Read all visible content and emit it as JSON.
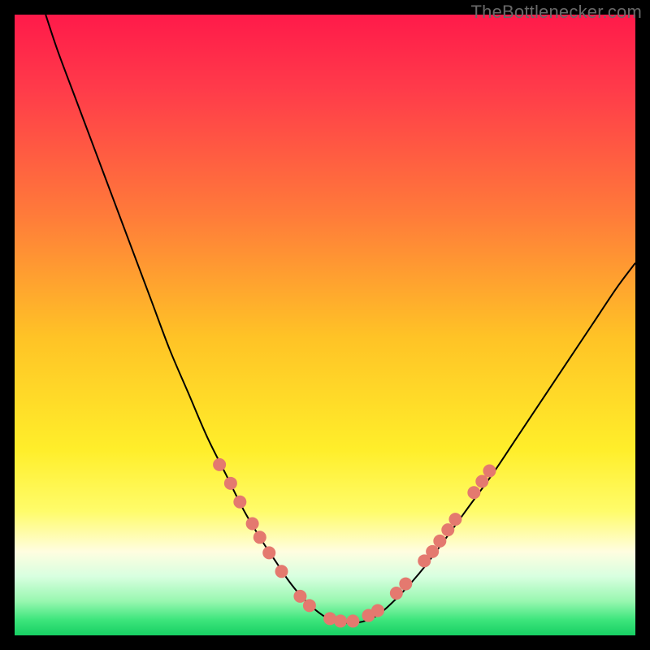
{
  "watermark": "TheBottlenecker.com",
  "chart_data": {
    "type": "line",
    "title": "",
    "xlabel": "",
    "ylabel": "",
    "xlim": [
      0,
      100
    ],
    "ylim": [
      0,
      100
    ],
    "background_gradient": {
      "stops": [
        {
          "offset": 0.0,
          "color": "#ff1a4a"
        },
        {
          "offset": 0.12,
          "color": "#ff3b4a"
        },
        {
          "offset": 0.32,
          "color": "#ff7a3a"
        },
        {
          "offset": 0.52,
          "color": "#ffc326"
        },
        {
          "offset": 0.7,
          "color": "#ffee2a"
        },
        {
          "offset": 0.8,
          "color": "#fffc6a"
        },
        {
          "offset": 0.865,
          "color": "#fffde0"
        },
        {
          "offset": 0.905,
          "color": "#d8ffe0"
        },
        {
          "offset": 0.945,
          "color": "#98f7b0"
        },
        {
          "offset": 0.975,
          "color": "#3de57c"
        },
        {
          "offset": 1.0,
          "color": "#17cf63"
        }
      ]
    },
    "series": [
      {
        "name": "bottleneck-curve",
        "color": "#000000",
        "width": 2,
        "x": [
          5,
          7,
          10,
          13,
          16,
          19,
          22,
          25,
          28,
          31,
          34,
          37,
          40,
          42,
          44,
          46,
          48,
          50,
          52,
          54,
          56,
          58,
          60,
          63,
          66,
          69,
          73,
          77,
          81,
          85,
          89,
          93,
          97,
          100
        ],
        "values": [
          100,
          94,
          86,
          78,
          70,
          62,
          54,
          46,
          39,
          32,
          26,
          20,
          15,
          12,
          9,
          6.5,
          4.5,
          3,
          2.2,
          2,
          2.2,
          3,
          4.5,
          7.5,
          11,
          15,
          20.5,
          26,
          32,
          38,
          44,
          50,
          56,
          60
        ]
      }
    ],
    "beads": {
      "color": "#e4796f",
      "radius": 8,
      "points": [
        {
          "x": 33.0,
          "y": 27.5
        },
        {
          "x": 34.8,
          "y": 24.5
        },
        {
          "x": 36.3,
          "y": 21.5
        },
        {
          "x": 38.3,
          "y": 18.0
        },
        {
          "x": 39.5,
          "y": 15.8
        },
        {
          "x": 41.0,
          "y": 13.3
        },
        {
          "x": 43.0,
          "y": 10.3
        },
        {
          "x": 46.0,
          "y": 6.3
        },
        {
          "x": 47.5,
          "y": 4.8
        },
        {
          "x": 50.8,
          "y": 2.7
        },
        {
          "x": 52.5,
          "y": 2.3
        },
        {
          "x": 54.5,
          "y": 2.3
        },
        {
          "x": 57.0,
          "y": 3.2
        },
        {
          "x": 58.5,
          "y": 4.0
        },
        {
          "x": 61.5,
          "y": 6.8
        },
        {
          "x": 63.0,
          "y": 8.3
        },
        {
          "x": 66.0,
          "y": 12.0
        },
        {
          "x": 67.3,
          "y": 13.5
        },
        {
          "x": 68.5,
          "y": 15.2
        },
        {
          "x": 69.8,
          "y": 17.0
        },
        {
          "x": 71.0,
          "y": 18.7
        },
        {
          "x": 74.0,
          "y": 23.0
        },
        {
          "x": 75.3,
          "y": 24.8
        },
        {
          "x": 76.5,
          "y": 26.5
        }
      ]
    }
  }
}
